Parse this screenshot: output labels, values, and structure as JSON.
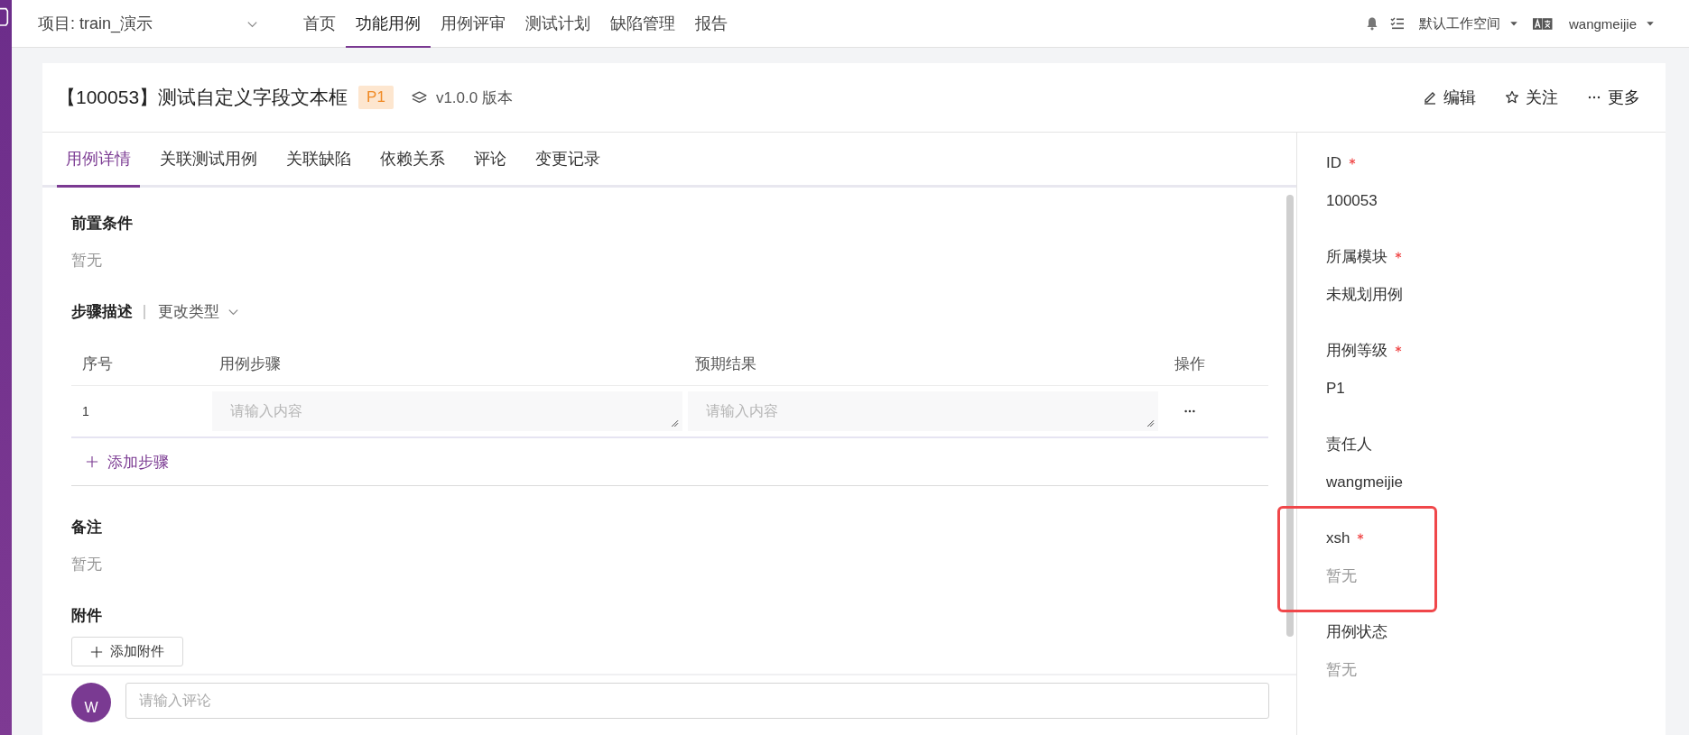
{
  "top_bar": {
    "project": "项目: train_演示",
    "nav": [
      {
        "label": "首页",
        "selected": false
      },
      {
        "label": "功能用例",
        "selected": true
      },
      {
        "label": "用例评审",
        "selected": false
      },
      {
        "label": "测试计划",
        "selected": false
      },
      {
        "label": "缺陷管理",
        "selected": false
      },
      {
        "label": "报告",
        "selected": false
      }
    ],
    "workspace": "默认工作空间",
    "user": "wangmeijie"
  },
  "case": {
    "title": "【100053】测试自定义字段文本框",
    "priority": "P1",
    "version": "v1.0.0 版本",
    "actions": [
      {
        "kind": "edit",
        "label": "编辑"
      },
      {
        "kind": "follow",
        "label": "关注"
      },
      {
        "kind": "more",
        "label": "更多"
      }
    ]
  },
  "tabs": [
    {
      "label": "用例详情",
      "selected": true
    },
    {
      "label": "关联测试用例",
      "selected": false
    },
    {
      "label": "关联缺陷",
      "selected": false
    },
    {
      "label": "依赖关系",
      "selected": false
    },
    {
      "label": "评论",
      "selected": false
    },
    {
      "label": "变更记录",
      "selected": false
    }
  ],
  "sections": [
    {
      "kind": "text",
      "title": "前置条件",
      "value": "暂无"
    },
    {
      "kind": "steps",
      "title": "步骤描述",
      "type_switch": "更改类型",
      "columns": [
        "序号",
        "用例步骤",
        "预期结果",
        "操作"
      ],
      "rows": [
        {
          "index": "1",
          "step_placeholder": "请输入内容",
          "result_placeholder": "请输入内容"
        }
      ],
      "add_label": "添加步骤"
    },
    {
      "kind": "text",
      "title": "备注",
      "value": "暂无"
    },
    {
      "kind": "attachments",
      "title": "附件",
      "button": "添加附件"
    }
  ],
  "comment": {
    "avatar": "W",
    "placeholder": "请输入评论"
  },
  "fields": [
    {
      "label": "ID",
      "required": true,
      "value": "100053",
      "empty": false,
      "highlighted": false
    },
    {
      "label": "所属模块",
      "required": true,
      "value": "未规划用例",
      "empty": false,
      "highlighted": false
    },
    {
      "label": "用例等级",
      "required": true,
      "value": "P1",
      "empty": false,
      "highlighted": false
    },
    {
      "label": "责任人",
      "required": false,
      "value": "wangmeijie",
      "empty": false,
      "highlighted": false
    },
    {
      "label": "xsh",
      "required": true,
      "value": "暂无",
      "empty": true,
      "highlighted": true
    },
    {
      "label": "用例状态",
      "required": false,
      "value": "暂无",
      "empty": true,
      "highlighted": false
    }
  ]
}
